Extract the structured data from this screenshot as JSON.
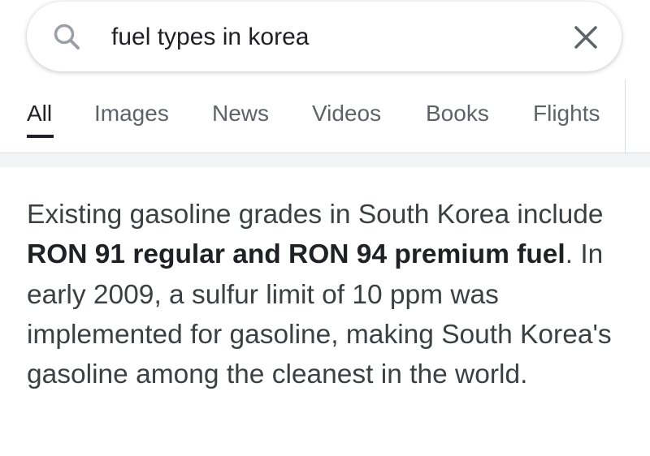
{
  "search": {
    "query": "fuel types in korea",
    "search_icon": "search-icon",
    "clear_icon": "close-icon"
  },
  "tabs": [
    {
      "label": "All",
      "active": true
    },
    {
      "label": "Images",
      "active": false
    },
    {
      "label": "News",
      "active": false
    },
    {
      "label": "Videos",
      "active": false
    },
    {
      "label": "Books",
      "active": false
    },
    {
      "label": "Flights",
      "active": false
    }
  ],
  "snippet": {
    "text_before": "Existing gasoline grades in South Korea include ",
    "highlight": "RON 91 regular and RON 94 premium fuel",
    "text_after": ". In early 2009, a sulfur limit of 10 ppm was implemented for gasoline, making South Korea's gasoline among the cleanest in the world."
  },
  "colors": {
    "text_primary": "#202124",
    "text_secondary": "#5f6368",
    "band": "#f1f3f4"
  }
}
